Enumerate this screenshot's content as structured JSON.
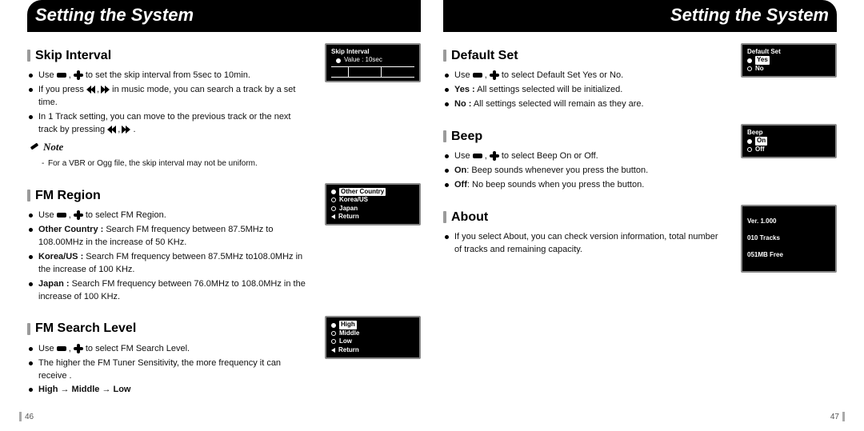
{
  "header": {
    "title_left": "Setting the System",
    "title_right": "Setting the System"
  },
  "pages": {
    "left": "46",
    "right": "47"
  },
  "icons": {
    "use_prefix": "Use ",
    "comma_sep": " , "
  },
  "skip": {
    "title": "Skip Interval",
    "b1a": "to set the skip interval from 5sec to 10min.",
    "b2a": "If you press ",
    "b2b": " in music mode, you can search a track by a set time.",
    "b3a": "In 1 Track setting, you can move to the previous track or the next track by pressing ",
    "b3b": " .",
    "note_label": "Note",
    "note1": "For a VBR or Ogg file, the skip interval may not be uniform.",
    "shot_title": "Skip Interval",
    "shot_value_label": "Value : 10sec"
  },
  "fmregion": {
    "title": "FM Region",
    "b1": "to select FM Region.",
    "b2_label": "Other Country :",
    "b2_text": " Search FM frequency between 87.5MHz to 108.00MHz in the increase of 50 KHz.",
    "b3_label": "Korea/US :",
    "b3_text": " Search FM frequency between 87.5MHz to108.0MHz in the increase of 100 KHz.",
    "b4_label": "Japan :",
    "b4_text": " Search FM frequency between 76.0MHz to 108.0MHz in the increase of 100 KHz.",
    "shot": {
      "opt1": "Other Country",
      "opt2": "Korea/US",
      "opt3": "Japan",
      "ret": "Return"
    }
  },
  "fmsearch": {
    "title": "FM Search Level",
    "b1": "to select FM Search Level.",
    "b2": "The higher the FM Tuner Sensitivity, the more frequency it can receive .",
    "b3": "High → Middle → Low",
    "shot": {
      "opt1": "High",
      "opt2": "Middle",
      "opt3": "Low",
      "ret": "Return"
    }
  },
  "defaultset": {
    "title": "Default Set",
    "b1": "to select Default Set Yes or No.",
    "b2_label": "Yes :",
    "b2_text": " All settings selected will be initialized.",
    "b3_label": "No :",
    "b3_text": " All settings selected will remain as they are.",
    "shot": {
      "title": "Default Set",
      "opt1": "Yes",
      "opt2": "No"
    }
  },
  "beep": {
    "title": "Beep",
    "b1": "to select Beep On or Off.",
    "b2_label": "On",
    "b2_text": ": Beep sounds whenever you press the button.",
    "b3_label": "Off",
    "b3_text": ": No beep sounds when you press the button.",
    "shot": {
      "title": "Beep",
      "opt1": "On",
      "opt2": "Off"
    }
  },
  "about": {
    "title": "About",
    "b1": "If you select About, you can check version information, total number of tracks and remaining capacity.",
    "shot_line1": "Ver.  1.000",
    "shot_line2": "010 Tracks",
    "shot_line3": "051MB Free"
  }
}
